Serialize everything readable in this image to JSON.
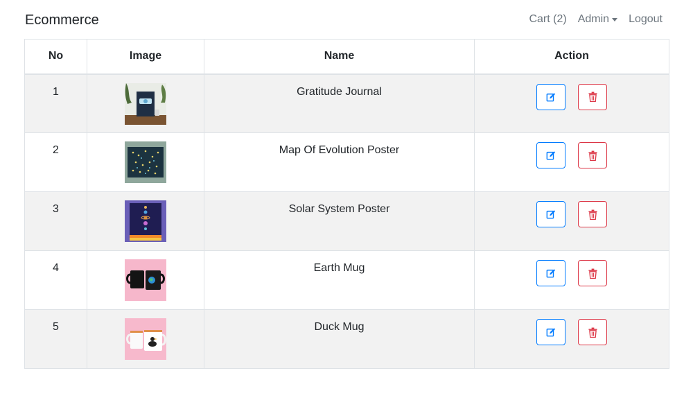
{
  "brand": "Ecommerce",
  "nav": {
    "cart": "Cart (2)",
    "admin": "Admin",
    "logout": "Logout"
  },
  "table": {
    "headers": [
      "No",
      "Image",
      "Name",
      "Action"
    ],
    "rows": [
      {
        "no": "1",
        "name": "Gratitude Journal",
        "image": "gratitude-journal-thumbnail"
      },
      {
        "no": "2",
        "name": "Map Of Evolution Poster",
        "image": "evolution-poster-thumbnail"
      },
      {
        "no": "3",
        "name": "Solar System Poster",
        "image": "solar-system-poster-thumbnail"
      },
      {
        "no": "4",
        "name": "Earth Mug",
        "image": "earth-mug-thumbnail"
      },
      {
        "no": "5",
        "name": "Duck Mug",
        "image": "duck-mug-thumbnail"
      }
    ]
  },
  "icons": {
    "edit": "edit-icon",
    "delete": "trash-icon"
  },
  "colors": {
    "primary": "#007bff",
    "danger": "#dc3545",
    "striped_row": "#f2f2f2",
    "border": "#dee2e6",
    "nav_link": "#6c757d"
  }
}
